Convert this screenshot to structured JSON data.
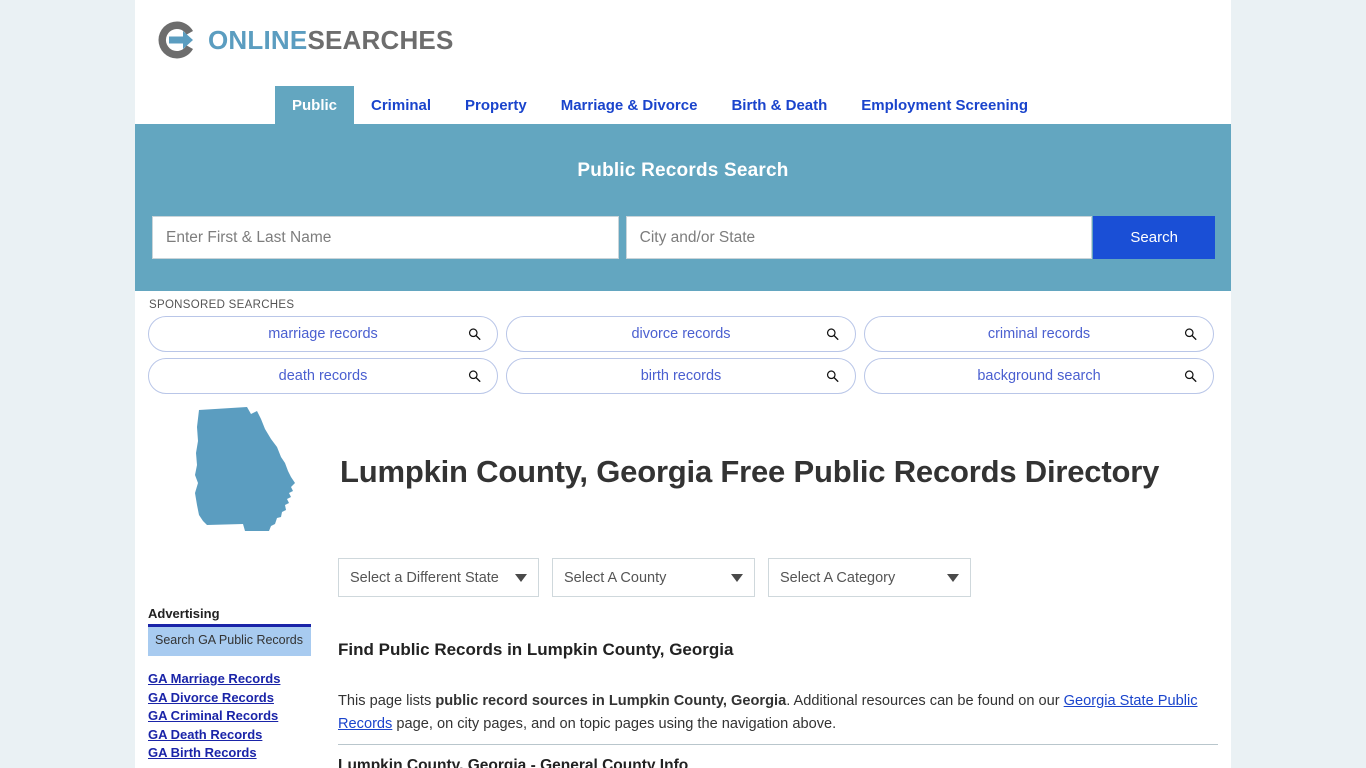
{
  "brand": {
    "name_part1": "ONLINE",
    "name_part2": "SEARCHES",
    "logo_icon": "circle-arrow-logo-icon",
    "accent_blue": "#5b9dc0",
    "accent_gray": "#6d6d6d"
  },
  "nav": {
    "items": [
      {
        "label": "Public",
        "active": true
      },
      {
        "label": "Criminal",
        "active": false
      },
      {
        "label": "Property",
        "active": false
      },
      {
        "label": "Marriage & Divorce",
        "active": false
      },
      {
        "label": "Birth & Death",
        "active": false
      },
      {
        "label": "Employment Screening",
        "active": false
      }
    ]
  },
  "banner": {
    "title": "Public Records Search",
    "background": "#63a6c0",
    "name_placeholder": "Enter First & Last Name",
    "name_value": "",
    "city_placeholder": "City and/or State",
    "city_value": "",
    "search_label": "Search",
    "search_button_color": "#1a4fd6"
  },
  "sponsored": {
    "label": "SPONSORED SEARCHES",
    "pills": [
      {
        "label": "marriage records",
        "icon": "search-icon"
      },
      {
        "label": "divorce records",
        "icon": "search-icon"
      },
      {
        "label": "criminal records",
        "icon": "search-icon"
      },
      {
        "label": "death records",
        "icon": "search-icon"
      },
      {
        "label": "birth records",
        "icon": "search-icon"
      },
      {
        "label": "background search",
        "icon": "search-icon"
      }
    ]
  },
  "hero": {
    "state_map_icon": "georgia-state-map-icon",
    "state_map_color": "#5b9dc0",
    "title": "Lumpkin County, Georgia Free Public Records Directory"
  },
  "selects": {
    "state": {
      "label": "Select a Different State",
      "icon": "chevron-down-icon"
    },
    "county": {
      "label": "Select A County",
      "icon": "chevron-down-icon"
    },
    "category": {
      "label": "Select A Category",
      "icon": "chevron-down-icon"
    }
  },
  "sidebar": {
    "advertising_label": "Advertising",
    "ad_text": "Search GA Public Records",
    "links": [
      {
        "label": "GA Marriage Records"
      },
      {
        "label": "GA Divorce Records"
      },
      {
        "label": "GA Criminal Records"
      },
      {
        "label": "GA Death Records"
      },
      {
        "label": "GA Birth Records"
      }
    ]
  },
  "main": {
    "section_heading": "Find Public Records in Lumpkin County, Georgia",
    "paragraph": {
      "lead": "This page lists ",
      "bold": "public record sources in Lumpkin County, Georgia",
      "mid": ". Additional resources can be found on our ",
      "link": "Georgia State Public Records",
      "tail": " page, on city pages, and on topic pages using the navigation above."
    },
    "bottom_heading": "Lumpkin County, Georgia - General County Info"
  }
}
